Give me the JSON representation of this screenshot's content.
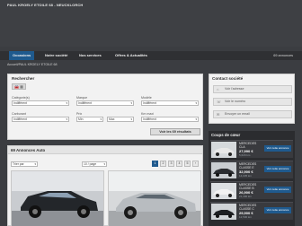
{
  "header": {
    "site_title": "PAUL KROELY ETOILE 68 - NEUCKLORCH"
  },
  "nav": {
    "items": [
      "Occasions",
      "Notre société",
      "Nos services",
      "Offres & Actualités"
    ],
    "ad_count": "69 annonces"
  },
  "breadcrumb": "Accueil/PAUL KROELY ETOILE 68",
  "search": {
    "title": "Rechercher",
    "fields": [
      {
        "label": "Catégorie(s)",
        "value": "Indifférent"
      },
      {
        "label": "Marque",
        "value": "Indifférent"
      },
      {
        "label": "Modèle",
        "value": "Indifférent"
      },
      {
        "label": "Carburant",
        "value": "Indifférent"
      },
      {
        "label": "Prix",
        "min": "Min",
        "max": "Max"
      },
      {
        "label": "Km maxi",
        "value": "Indifférent"
      }
    ],
    "results_button": "Voir les 69 résultats"
  },
  "contact": {
    "title": "Contact société",
    "address": "Voir l'adresse",
    "phone": "Voir le numéro",
    "email": "Envoyer un email"
  },
  "listing": {
    "title": "69 Annonces Auto",
    "sort_value": "Trier par",
    "per_page_value": "10 / page",
    "pages": [
      "1",
      "2",
      "3",
      "4",
      "5",
      "›"
    ]
  },
  "coups": {
    "title": "Coups de cœur",
    "items": [
      {
        "make": "MERCEDES",
        "model": "CLA",
        "price": "27,990 €",
        "km": "5,629 km",
        "button": "Voir cette annonce"
      },
      {
        "make": "MERCEDES",
        "model": "CLASSE E",
        "price": "32,900 €",
        "km": "14,035 km",
        "button": "Voir cette annonce"
      },
      {
        "make": "MERCEDES",
        "model": "CLASSE B",
        "price": "26,900 €",
        "km": "21,400 km",
        "button": "Voir cette annonce"
      },
      {
        "make": "MERCEDES",
        "model": "CLASSE C",
        "price": "29,900 €",
        "km": "12,500 km",
        "button": "Voir cette annonce"
      }
    ]
  }
}
